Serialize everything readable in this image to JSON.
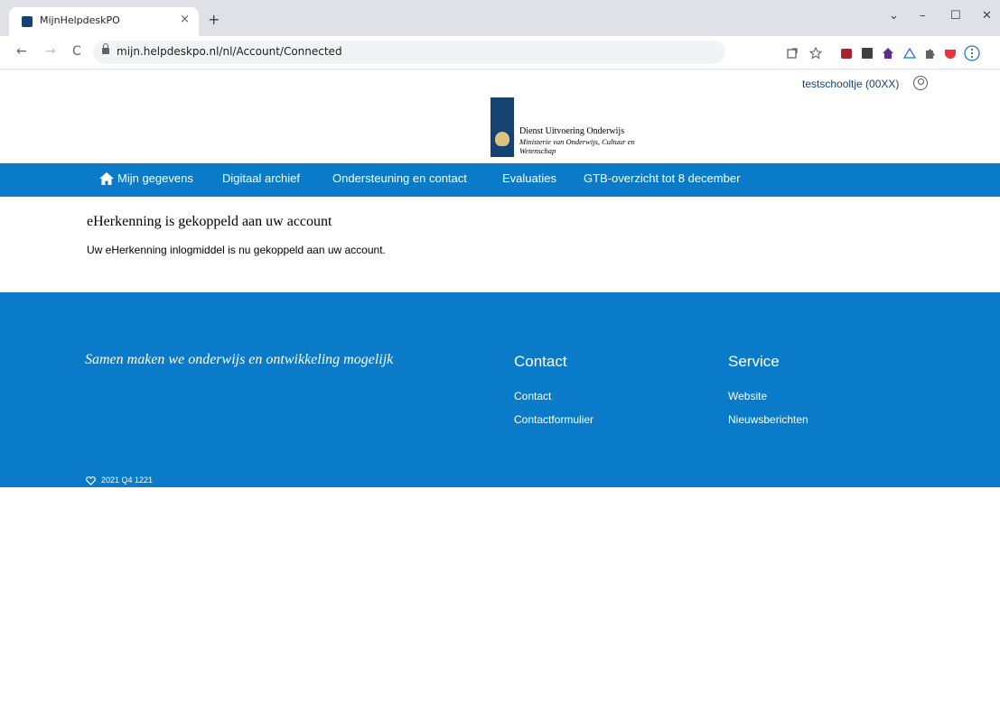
{
  "browser": {
    "tab_title": "MijnHelpdeskPO",
    "tab_close": "×",
    "new_tab": "+",
    "url": "mijn.helpdeskpo.nl/nl/Account/Connected",
    "window_buttons": {
      "collapse": "⌄",
      "minimize": "–",
      "maximize": "☐",
      "close": "✕"
    },
    "nav_icons": {
      "back": "←",
      "forward": "→",
      "reload": "C"
    }
  },
  "header": {
    "account_label": "testschooltje (00XX)",
    "logo_line1": "Dienst Uitvoering Onderwijs",
    "logo_line2": "Ministerie van Onderwijs, Cultuur en Wetenschap"
  },
  "nav": {
    "items": [
      "Mijn gegevens",
      "Digitaal archief",
      "Ondersteuning en contact",
      "Evaluaties",
      "GTB-overzicht tot 8 december"
    ]
  },
  "main": {
    "heading": "eHerkenning is gekoppeld aan uw account",
    "body": "Uw eHerkenning inlogmiddel is nu gekoppeld aan uw account."
  },
  "footer": {
    "slogan": "Samen maken we onderwijs en ontwikkeling mogelijk",
    "contact_title": "Contact",
    "contact_links": [
      "Contact",
      "Contactformulier"
    ],
    "service_title": "Service",
    "service_links": [
      "Website",
      "Nieuwsberichten"
    ],
    "version": "2021 Q4 1221"
  },
  "colors": {
    "brand_blue": "#0a7bc8",
    "rijks_blue": "#154273"
  }
}
